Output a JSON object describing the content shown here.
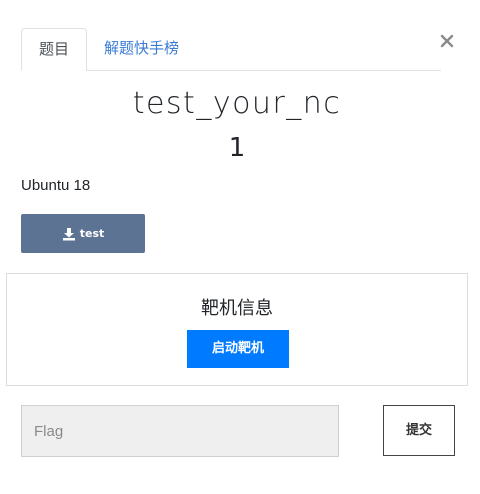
{
  "tabs": [
    {
      "label": "题目",
      "active": true
    },
    {
      "label": "解题快手榜",
      "active": false
    }
  ],
  "close_icon": "close-icon",
  "challenge": {
    "name": "test_your_nc",
    "score": "1",
    "description": "Ubuntu 18",
    "file_label": "test",
    "file_icon": "download-icon"
  },
  "target": {
    "title": "靶机信息",
    "start_label": "启动靶机"
  },
  "flag": {
    "placeholder": "Flag",
    "value": "",
    "submit_label": "提交"
  },
  "colors": {
    "tab_link": "#3a7bd5",
    "download_button": "#5c7394",
    "start_button": "#007bff"
  }
}
